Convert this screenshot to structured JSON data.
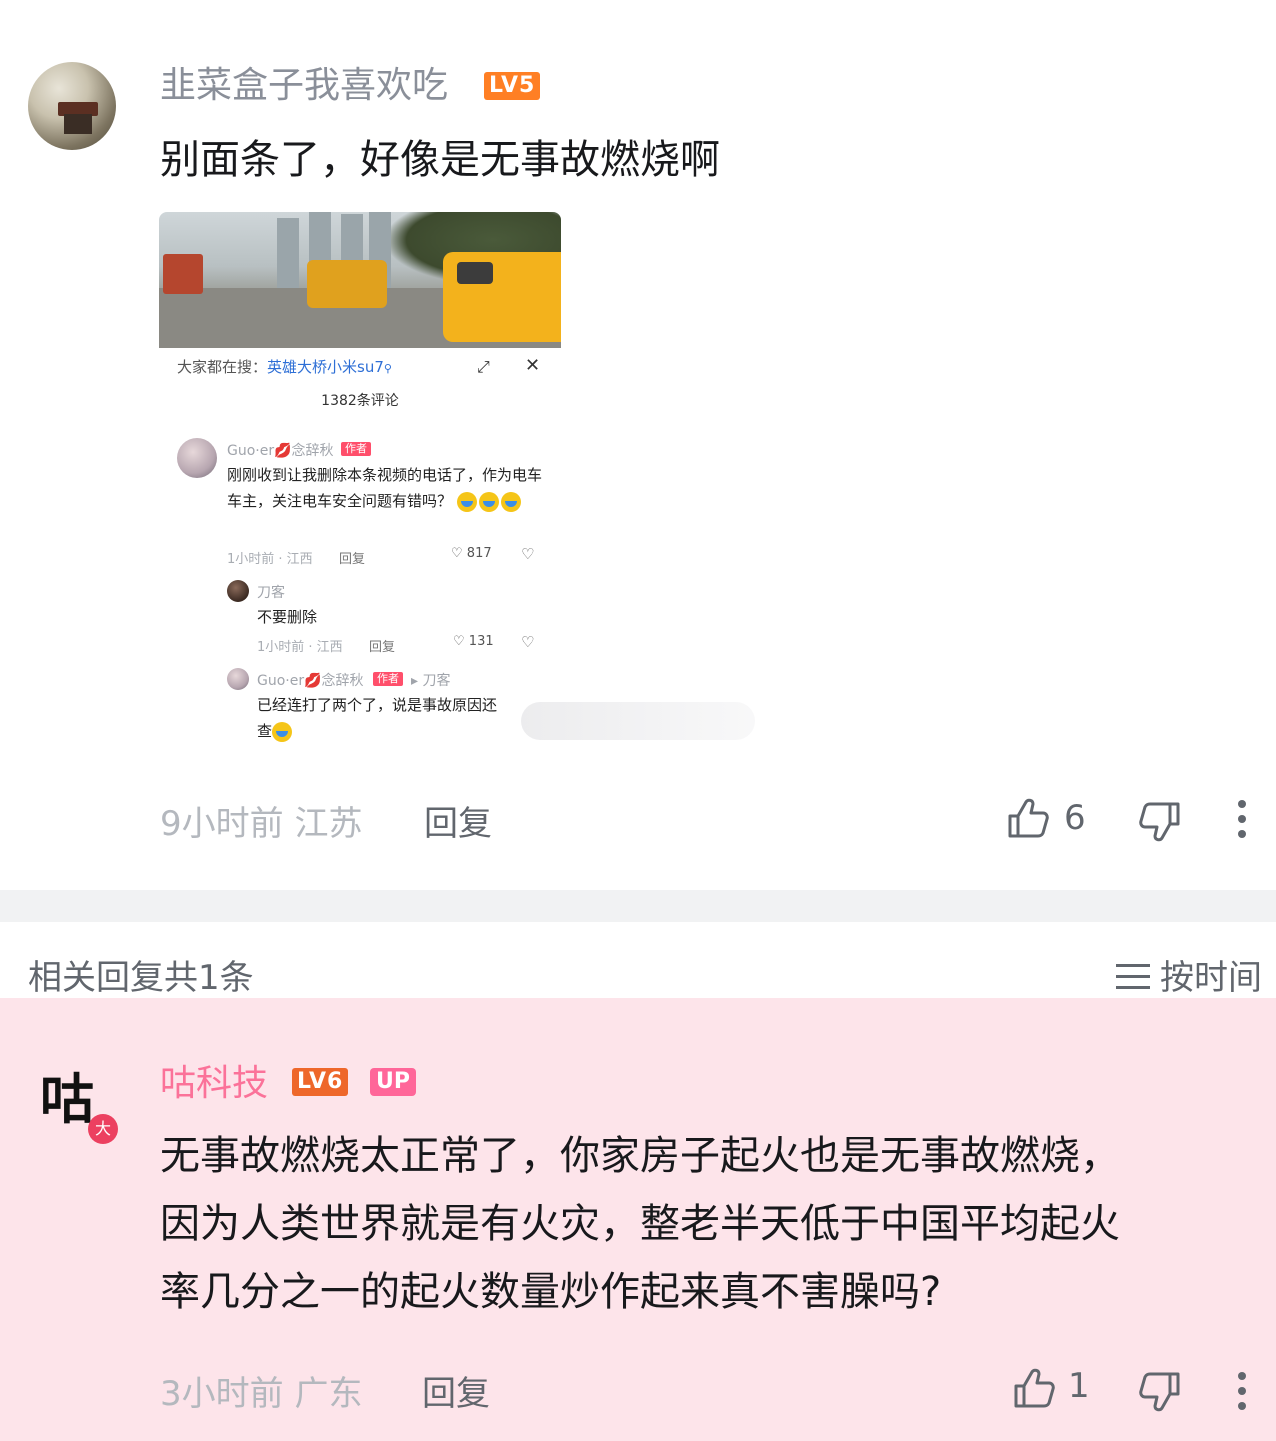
{
  "main_comment": {
    "username": "韭菜盒子我喜欢吃",
    "level": "LV5",
    "text": "别面条了，好像是无事故燃烧啊",
    "time": "9小时前",
    "location": "江苏",
    "reply_label": "回复",
    "like_count": "6",
    "screenshot": {
      "search_prefix": "大家都在搜：",
      "search_keyword": "英雄大桥小米su7",
      "comment_count": "1382条评论",
      "comment1": {
        "name": "Guo·er💋念辞秋",
        "tag": "作者",
        "text": "刚刚收到让我删除本条视频的电话了，作为电车车主，关注电车安全问题有错吗？",
        "meta": "1小时前 · 江西",
        "reply": "回复",
        "likes": "817"
      },
      "comment2": {
        "name": "刀客",
        "text": "不要删除",
        "meta": "1小时前 · 江西",
        "reply": "回复",
        "likes": "131"
      },
      "comment3": {
        "name": "Guo·er💋念辞秋",
        "tag": "作者",
        "reply_to": "▸ 刀客",
        "text_line1": "已经连打了两个了，说是事故原因还",
        "text_line2": "查"
      }
    }
  },
  "related": {
    "title": "相关回复共1条",
    "sort_label": "按时间"
  },
  "reply": {
    "avatar_char": "咕",
    "avatar_badge": "大",
    "username": "咕科技",
    "level": "LV6",
    "up_badge": "UP",
    "text_line1": "无事故燃烧太正常了，你家房子起火也是无事故燃烧，",
    "text_line2": "因为人类世界就是有火灾，整老半天低于中国平均起火",
    "text_line3": "率几分之一的起火数量炒作起来真不害臊吗?",
    "time": "3小时前",
    "location": "广东",
    "reply_label": "回复",
    "like_count": "1"
  },
  "colors": {
    "accent_pink": "#fb7299",
    "reply_bg": "#fde4ea",
    "level5": "#ff7f24",
    "level6": "#ee672a"
  }
}
